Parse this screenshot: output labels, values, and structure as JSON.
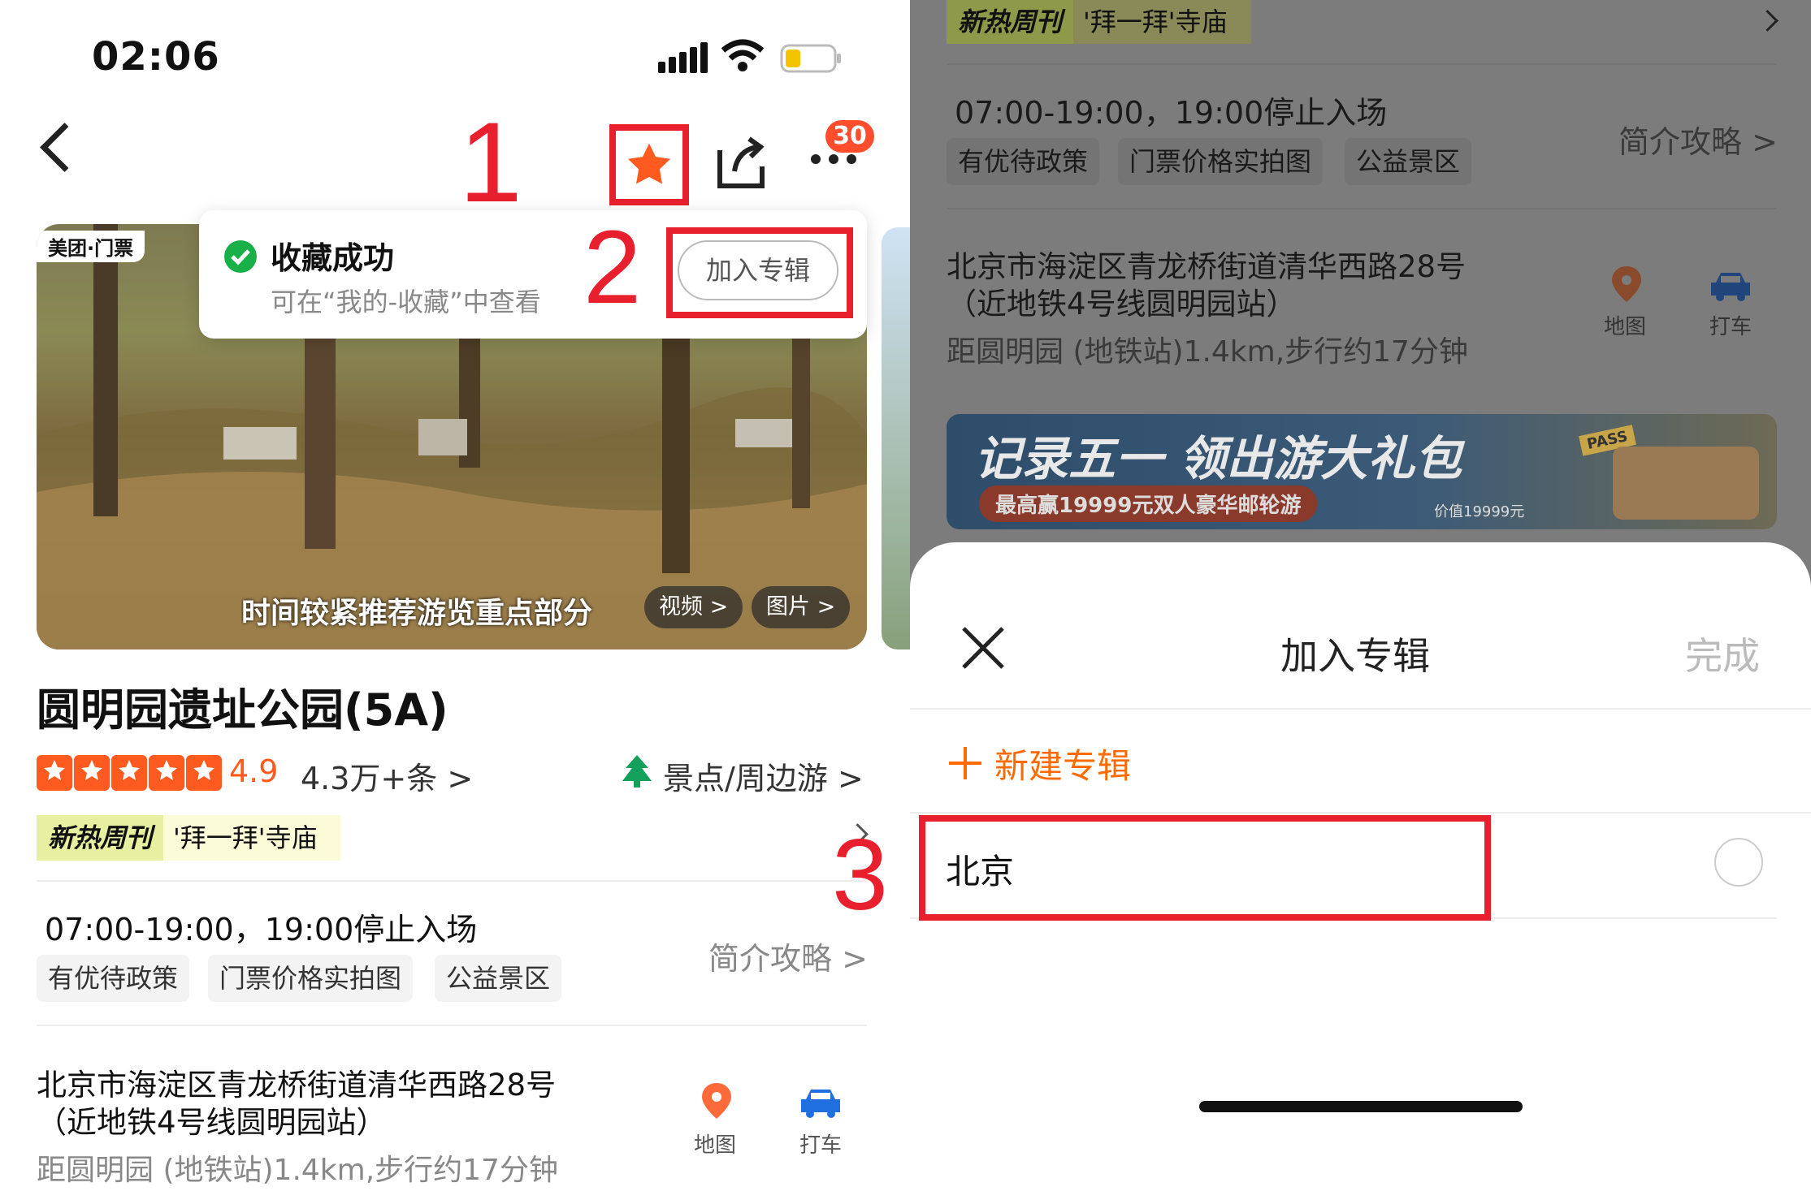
{
  "status_bar": {
    "time": "02:06"
  },
  "header": {
    "badge_count": "30"
  },
  "annotations": {
    "step1": "1",
    "step2": "2",
    "step3": "3"
  },
  "toast": {
    "title": "收藏成功",
    "subtitle": "可在“我的-收藏”中查看",
    "button": "加入专辑"
  },
  "hero": {
    "brand": "美团·门票",
    "caption": "时间较紧推荐游览重点部分",
    "video_btn": "视频 >",
    "photo_btn": "图片 >"
  },
  "attraction": {
    "name": "圆明园遗址公园(5A)",
    "rating": "4.9",
    "reviews": "4.3万+条 >",
    "category": "景点/周边游 >",
    "promo_tag": "新热周刊",
    "promo_text": "'拜一拜'寺庙",
    "hours": "07:00-19:00，19:00停止入场",
    "chips": [
      "有优待政策",
      "门票价格实拍图",
      "公益景区"
    ],
    "guide": "简介攻略 >",
    "address_line1": "北京市海淀区青龙桥街道清华西路28号",
    "address_line2": "（近地铁4号线圆明园站）",
    "distance": "距圆明园 (地铁站)1.4km,步行约17分钟",
    "map_label": "地图",
    "taxi_label": "打车"
  },
  "banner": {
    "title": "记录五一 领出游大礼包",
    "subtitle": "最高赢19999元双人豪华邮轮游",
    "value": "价值19999元",
    "sticker": "PASS"
  },
  "sheet": {
    "title": "加入专辑",
    "done": "完成",
    "new_album": "新建专辑",
    "albums": [
      {
        "name": "北京"
      }
    ]
  },
  "colors": {
    "accent": "#ff6a00",
    "annotation": "#e8202e",
    "brand_yellow": "#ffd000",
    "taxi_blue": "#1f6fe0"
  }
}
